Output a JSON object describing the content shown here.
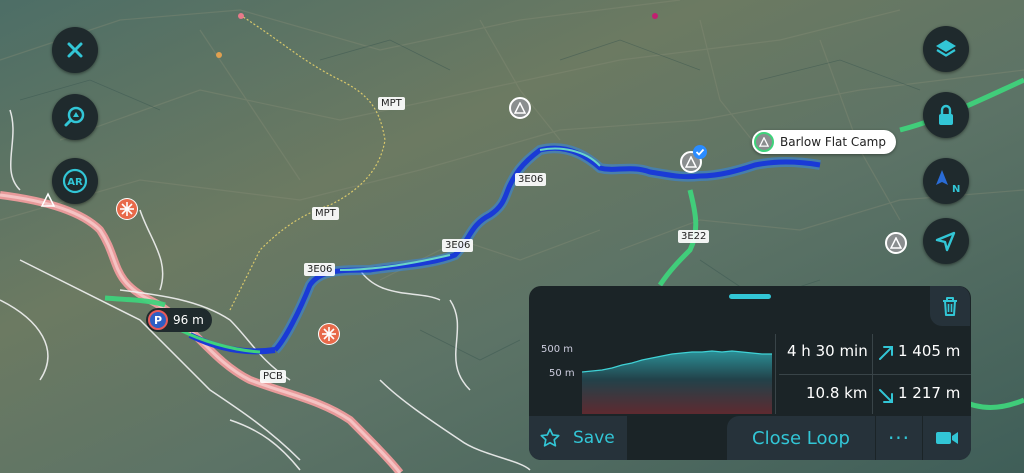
{
  "map": {
    "trail_labels": [
      "MPT",
      "MPT",
      "3E06",
      "3E06",
      "3E06",
      "3E22",
      "PCB"
    ],
    "campsite": "Barlow Flat Camp",
    "parking_distance": "96 m",
    "colors": {
      "route": "#1a3ad6",
      "route_glow": "#2a8cff",
      "trail_green": "#3fd27b",
      "road_pink": "#e89a9a",
      "accent": "#32c6d6"
    }
  },
  "left_controls": [
    "close-icon",
    "search-map-icon",
    "ar-icon"
  ],
  "ar_label": "AR",
  "right_controls": [
    "layers-icon",
    "lock-icon",
    "compass-north-icon",
    "location-arrow-icon"
  ],
  "compass_letter": "N",
  "panel": {
    "elev_high": "500 m",
    "elev_low": "50 m",
    "duration": "4 h 30 min",
    "ascent": "1 405 m",
    "distance": "10.8 km",
    "descent": "1 217 m",
    "save_label": "Save",
    "close_loop_label": "Close Loop",
    "more_label": "···"
  }
}
